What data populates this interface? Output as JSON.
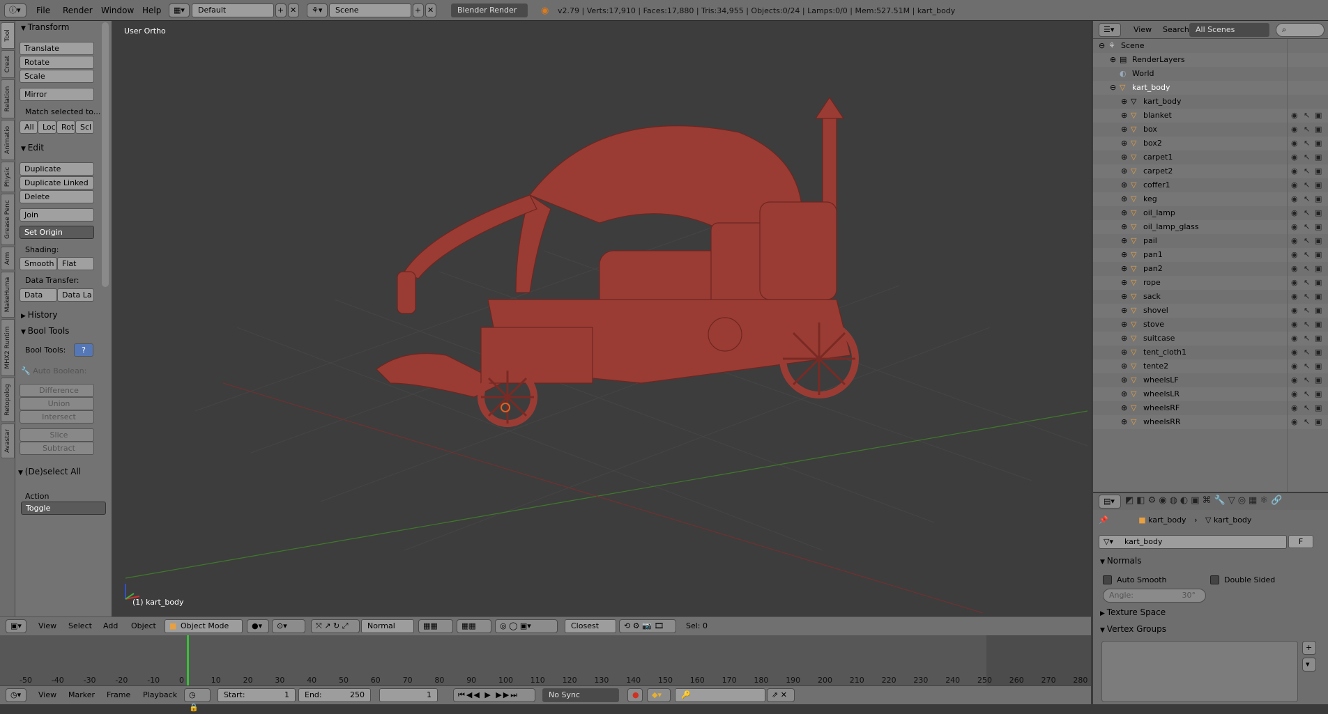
{
  "topbar": {
    "menus": [
      "File",
      "Render",
      "Window",
      "Help"
    ],
    "layout": "Default",
    "scene": "Scene",
    "engine": "Blender Render",
    "stats": "v2.79 | Verts:17,910 | Faces:17,880 | Tris:34,955 | Objects:0/24 | Lamps:0/0 | Mem:527.51M | kart_body"
  },
  "tabs": [
    "Tool",
    "Creat",
    "Relation",
    "Animatio",
    "Physic",
    "Grease Penc",
    "Arm",
    "MakeHuma",
    "MHX2 Runtim",
    "Retopolog",
    "Avastar"
  ],
  "toolshelf": {
    "transform": {
      "title": "Transform",
      "translate": "Translate",
      "rotate": "Rotate",
      "scale": "Scale",
      "mirror": "Mirror",
      "match": "Match selected to...",
      "all": "All",
      "loc": "Loc",
      "rot": "Rot",
      "scl": "Scl"
    },
    "edit": {
      "title": "Edit",
      "duplicate": "Duplicate",
      "duplicate_linked": "Duplicate Linked",
      "delete": "Delete",
      "join": "Join",
      "set_origin": "Set Origin",
      "shading": "Shading:",
      "smooth": "Smooth",
      "flat": "Flat",
      "data_transfer": "Data Transfer:",
      "data": "Data",
      "data_la": "Data La"
    },
    "history": "History",
    "booltools": {
      "title": "Bool Tools",
      "label": "Bool Tools:",
      "auto": "Auto Boolean:",
      "difference": "Difference",
      "union": "Union",
      "intersect": "Intersect",
      "slice": "Slice",
      "subtract": "Subtract"
    },
    "deselect": {
      "title": "(De)select All",
      "action": "Action",
      "toggle": "Toggle"
    }
  },
  "viewport": {
    "view_name": "User Ortho",
    "object_label": "(1) kart_body",
    "mesh_color": "#9a3c34"
  },
  "viewbar": {
    "menus": [
      "View",
      "Select",
      "Add",
      "Object"
    ],
    "mode": "Object Mode",
    "pivot": "Normal",
    "snap": "Closest",
    "sel": "Sel: 0"
  },
  "timeline": {
    "ticks": [
      "-50",
      "-40",
      "-30",
      "-20",
      "-10",
      "0",
      "10",
      "20",
      "30",
      "40",
      "50",
      "60",
      "70",
      "80",
      "90",
      "100",
      "110",
      "120",
      "130",
      "140",
      "150",
      "160",
      "170",
      "180",
      "190",
      "200",
      "210",
      "220",
      "230",
      "240",
      "250",
      "260",
      "270",
      "280"
    ],
    "current_frame": 0
  },
  "timebar": {
    "menus": [
      "View",
      "Marker",
      "Frame",
      "Playback"
    ],
    "start": "Start:",
    "start_val": "1",
    "end": "End:",
    "end_val": "250",
    "frame": "1",
    "sync": "No Sync"
  },
  "outliner": {
    "menus": [
      "View",
      "Search"
    ],
    "filter": "All Scenes",
    "scene": "Scene",
    "renderlayers": "RenderLayers",
    "world": "World",
    "root": "kart_body",
    "mesh": "kart_body",
    "items": [
      "blanket",
      "box",
      "box2",
      "carpet1",
      "carpet2",
      "coffer1",
      "keg",
      "oil_lamp",
      "oil_lamp_glass",
      "pail",
      "pan1",
      "pan2",
      "rope",
      "sack",
      "shovel",
      "stove",
      "suitcase",
      "tent_cloth1",
      "tente2",
      "wheelsLF",
      "wheelsLR",
      "wheelsRF",
      "wheelsRR"
    ]
  },
  "properties": {
    "crumb_obj": "kart_body",
    "crumb_mesh": "kart_body",
    "datablock": "kart_body",
    "fake": "F",
    "normals": "Normals",
    "auto_smooth": "Auto Smooth",
    "double_sided": "Double Sided",
    "angle": "Angle:",
    "angle_val": "30°",
    "texture_space": "Texture Space",
    "vertex_groups": "Vertex Groups"
  }
}
